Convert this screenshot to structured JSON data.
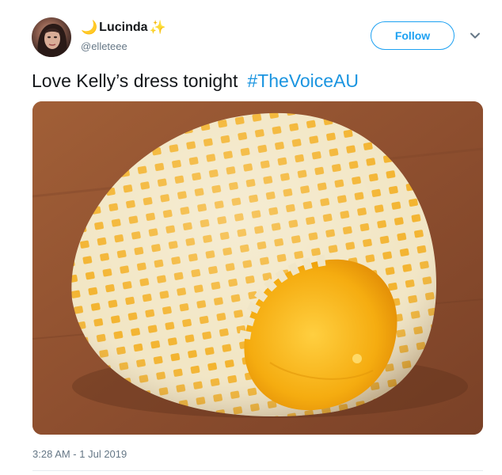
{
  "author": {
    "display_name": "Lucinda",
    "name_prefix_emoji": "🌙",
    "name_suffix_emoji": "✨",
    "handle": "@elleteee",
    "avatar_icon": "profile-photo"
  },
  "actions": {
    "follow_label": "Follow",
    "more_icon": "chevron-down-icon"
  },
  "tweet": {
    "text": "Love Kelly’s dress tonight",
    "hashtag": "#TheVoiceAU",
    "timestamp": "3:28 AM - 1 Jul 2019"
  },
  "colors": {
    "accent": "#1da1f2",
    "hashtag": "#1b95e0",
    "muted": "#657786"
  }
}
